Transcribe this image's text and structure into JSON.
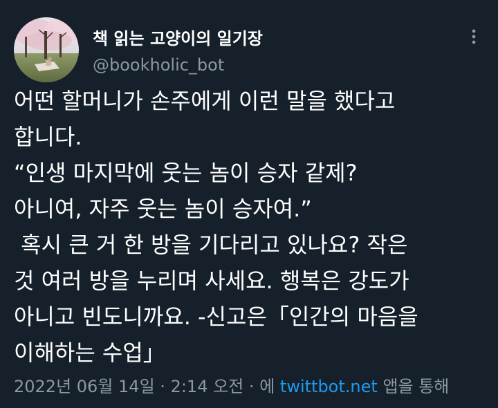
{
  "tweet": {
    "author_name": "책 읽는 고양이의 일기장",
    "author_handle": "@bookholic_bot",
    "lines": [
      "어떤 할머니가 손주에게 이런 말을 했다고",
      "합니다.",
      "“인생 마지막에 웃는 놈이 승자 같제?",
      "아니여, 자주 웃는 놈이 승자여.”",
      " 혹시 큰 거 한 방을 기다리고 있나요? 작은",
      "것 여러 방을 누리며 사세요. 행복은 강도가",
      "아니고 빈도니까요. -신고은「인간의 마음을",
      "이해하는 수업」"
    ],
    "date": "2022년 06월 14일",
    "time": "2:14 오전",
    "via_prefix": "에",
    "source": "twittbot.net",
    "via_suffix": "앱을 통해",
    "separator": "·",
    "colors": {
      "background": "#15202b",
      "text": "#ffffff",
      "muted": "#8b98a5",
      "link": "#1d9bf0"
    },
    "icons": {
      "more": "more-horizontal-icon"
    }
  }
}
